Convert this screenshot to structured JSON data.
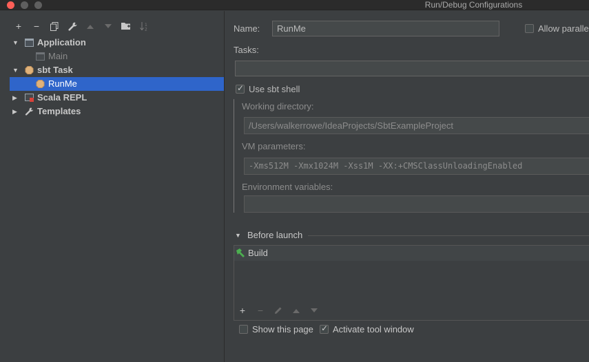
{
  "window": {
    "title": "Run/Debug Configurations"
  },
  "toolbar": {
    "add": "+",
    "remove": "−",
    "copy": "⧉",
    "wrench": "🔧",
    "up": "▲",
    "down": "▼",
    "folder": "▰",
    "sort": "↓²"
  },
  "tree": {
    "items": [
      {
        "label": "Application",
        "level": 0,
        "expanded": true
      },
      {
        "label": "Main",
        "level": 1
      },
      {
        "label": "sbt Task",
        "level": 0,
        "expanded": true
      },
      {
        "label": "RunMe",
        "level": 1,
        "selected": true
      },
      {
        "label": "Scala REPL",
        "level": 0,
        "expanded": false
      },
      {
        "label": "Templates",
        "level": 0,
        "expanded": false
      }
    ]
  },
  "config": {
    "name_label": "Name:",
    "name_value": "RunMe",
    "allow_parallel_label": "Allow paralle",
    "tasks_label": "Tasks:",
    "tasks_value": "",
    "use_sbt_shell_label": "Use sbt shell",
    "working_dir_label": "Working directory:",
    "working_dir_value": "/Users/walkerrowe/IdeaProjects/SbtExampleProject",
    "vm_params_label": "VM parameters:",
    "vm_params_value": "-Xms512M -Xmx1024M -Xss1M -XX:+CMSClassUnloadingEnabled",
    "env_vars_label": "Environment variables:",
    "env_vars_value": ""
  },
  "before_launch": {
    "title": "Before launch",
    "items": [
      {
        "label": "Build"
      }
    ],
    "toolbar": {
      "add": "+",
      "remove": "−",
      "edit": "✎",
      "up": "▲",
      "down": "▼"
    }
  },
  "footer": {
    "show_page_label": "Show this page",
    "activate_tool_label": "Activate tool window"
  },
  "colors": {
    "selection": "#2f65ca",
    "build_icon": "#4caf50",
    "close_button": "#ff5f57"
  }
}
